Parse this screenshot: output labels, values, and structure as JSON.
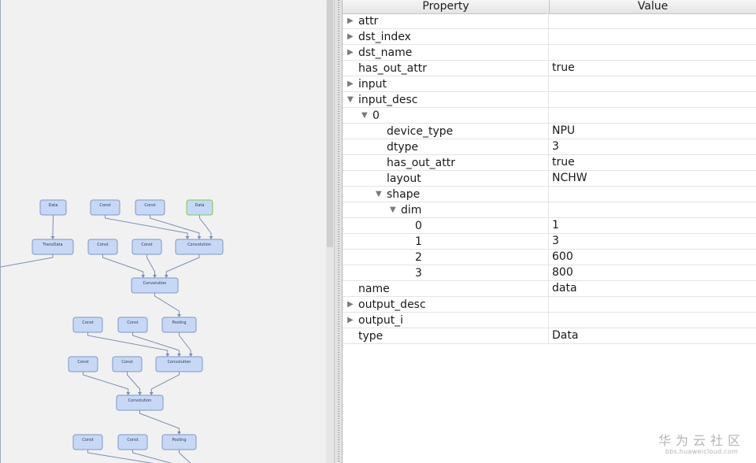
{
  "graph": {
    "nodes": [
      {
        "id": "n-data-1",
        "label": "Data"
      },
      {
        "id": "n-const-1",
        "label": "Const"
      },
      {
        "id": "n-const-2",
        "label": "Const"
      },
      {
        "id": "n-data-2",
        "label": "Data",
        "selected": true
      },
      {
        "id": "n-transdata",
        "label": "TransData"
      },
      {
        "id": "n-const-3",
        "label": "Const"
      },
      {
        "id": "n-const-4",
        "label": "Const"
      },
      {
        "id": "n-conv-1",
        "label": "Convolution"
      },
      {
        "id": "n-conv-2",
        "label": "Convolution"
      },
      {
        "id": "n-const-5",
        "label": "Const"
      },
      {
        "id": "n-const-6",
        "label": "Const"
      },
      {
        "id": "n-pool-1",
        "label": "Pooling"
      },
      {
        "id": "n-const-7",
        "label": "Const"
      },
      {
        "id": "n-const-8",
        "label": "Const"
      },
      {
        "id": "n-conv-3",
        "label": "Convolution"
      },
      {
        "id": "n-conv-4",
        "label": "Convolution"
      },
      {
        "id": "n-const-9",
        "label": "Const"
      },
      {
        "id": "n-const-10",
        "label": "Const"
      },
      {
        "id": "n-pool-2",
        "label": "Pooling"
      }
    ]
  },
  "properties": {
    "header": {
      "property": "Property",
      "value": "Value"
    },
    "rows": [
      {
        "label": "attr",
        "value": "",
        "depth": 0,
        "toggle": "collapsed"
      },
      {
        "label": "dst_index",
        "value": "",
        "depth": 0,
        "toggle": "collapsed"
      },
      {
        "label": "dst_name",
        "value": "",
        "depth": 0,
        "toggle": "collapsed"
      },
      {
        "label": "has_out_attr",
        "value": "true",
        "depth": 0,
        "toggle": "none"
      },
      {
        "label": "input",
        "value": "",
        "depth": 0,
        "toggle": "collapsed"
      },
      {
        "label": "input_desc",
        "value": "",
        "depth": 0,
        "toggle": "expanded"
      },
      {
        "label": "0",
        "value": "",
        "depth": 1,
        "toggle": "expanded"
      },
      {
        "label": "device_type",
        "value": "NPU",
        "depth": 2,
        "toggle": "none"
      },
      {
        "label": "dtype",
        "value": "3",
        "depth": 2,
        "toggle": "none"
      },
      {
        "label": "has_out_attr",
        "value": "true",
        "depth": 2,
        "toggle": "none"
      },
      {
        "label": "layout",
        "value": "NCHW",
        "depth": 2,
        "toggle": "none"
      },
      {
        "label": "shape",
        "value": "",
        "depth": 2,
        "toggle": "expanded"
      },
      {
        "label": "dim",
        "value": "",
        "depth": 3,
        "toggle": "expanded"
      },
      {
        "label": "0",
        "value": "1",
        "depth": 4,
        "toggle": "none"
      },
      {
        "label": "1",
        "value": "3",
        "depth": 4,
        "toggle": "none"
      },
      {
        "label": "2",
        "value": "600",
        "depth": 4,
        "toggle": "none"
      },
      {
        "label": "3",
        "value": "800",
        "depth": 4,
        "toggle": "none"
      },
      {
        "label": "name",
        "value": "data",
        "depth": 0,
        "toggle": "none"
      },
      {
        "label": "output_desc",
        "value": "",
        "depth": 0,
        "toggle": "collapsed"
      },
      {
        "label": "output_i",
        "value": "",
        "depth": 0,
        "toggle": "collapsed"
      },
      {
        "label": "type",
        "value": "Data",
        "depth": 0,
        "toggle": "none"
      }
    ]
  },
  "watermark": {
    "title": "华为云社区",
    "url": "bbs.huaweicloud.com"
  },
  "colors": {
    "node_fill": "#c7d8f6",
    "node_border": "#7d98c4",
    "selected_border": "#6fcf4a",
    "edge": "#7b8fb4"
  }
}
